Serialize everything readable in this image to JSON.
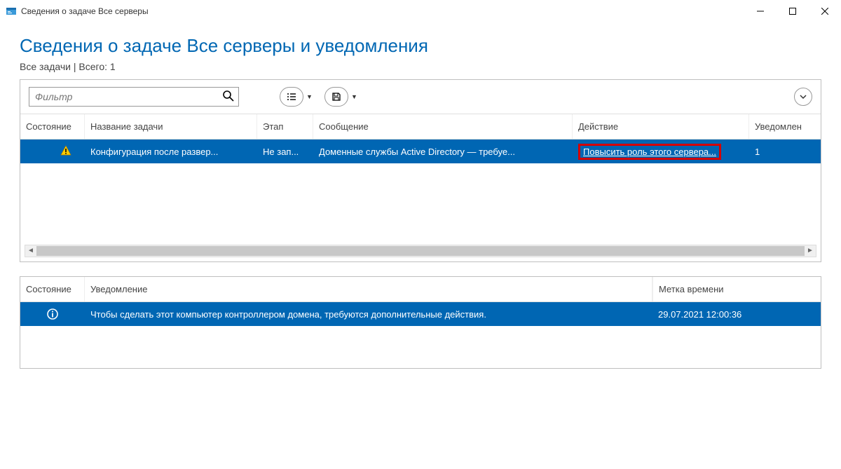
{
  "window": {
    "title": "Сведения о задаче Все серверы"
  },
  "page": {
    "title": "Сведения о задаче Все серверы и уведомления",
    "subtitle": "Все задачи | Всего: 1"
  },
  "toolbar": {
    "filter_placeholder": "Фильтр"
  },
  "tasks_table": {
    "headers": {
      "state": "Состояние",
      "task_name": "Название задачи",
      "stage": "Этап",
      "message": "Сообщение",
      "action": "Действие",
      "notifications": "Уведомлен"
    },
    "rows": [
      {
        "icon": "warning",
        "task_name": "Конфигурация после развер...",
        "stage": "Не зап...",
        "message": "Доменные службы Active Directory — требуе...",
        "action": "Повысить роль этого сервера...",
        "notifications": "1"
      }
    ]
  },
  "notifications_table": {
    "headers": {
      "state": "Состояние",
      "notification": "Уведомление",
      "timestamp": "Метка времени"
    },
    "rows": [
      {
        "icon": "info",
        "notification": "Чтобы сделать этот компьютер контроллером домена, требуются дополнительные действия.",
        "timestamp": "29.07.2021 12:00:36"
      }
    ]
  }
}
